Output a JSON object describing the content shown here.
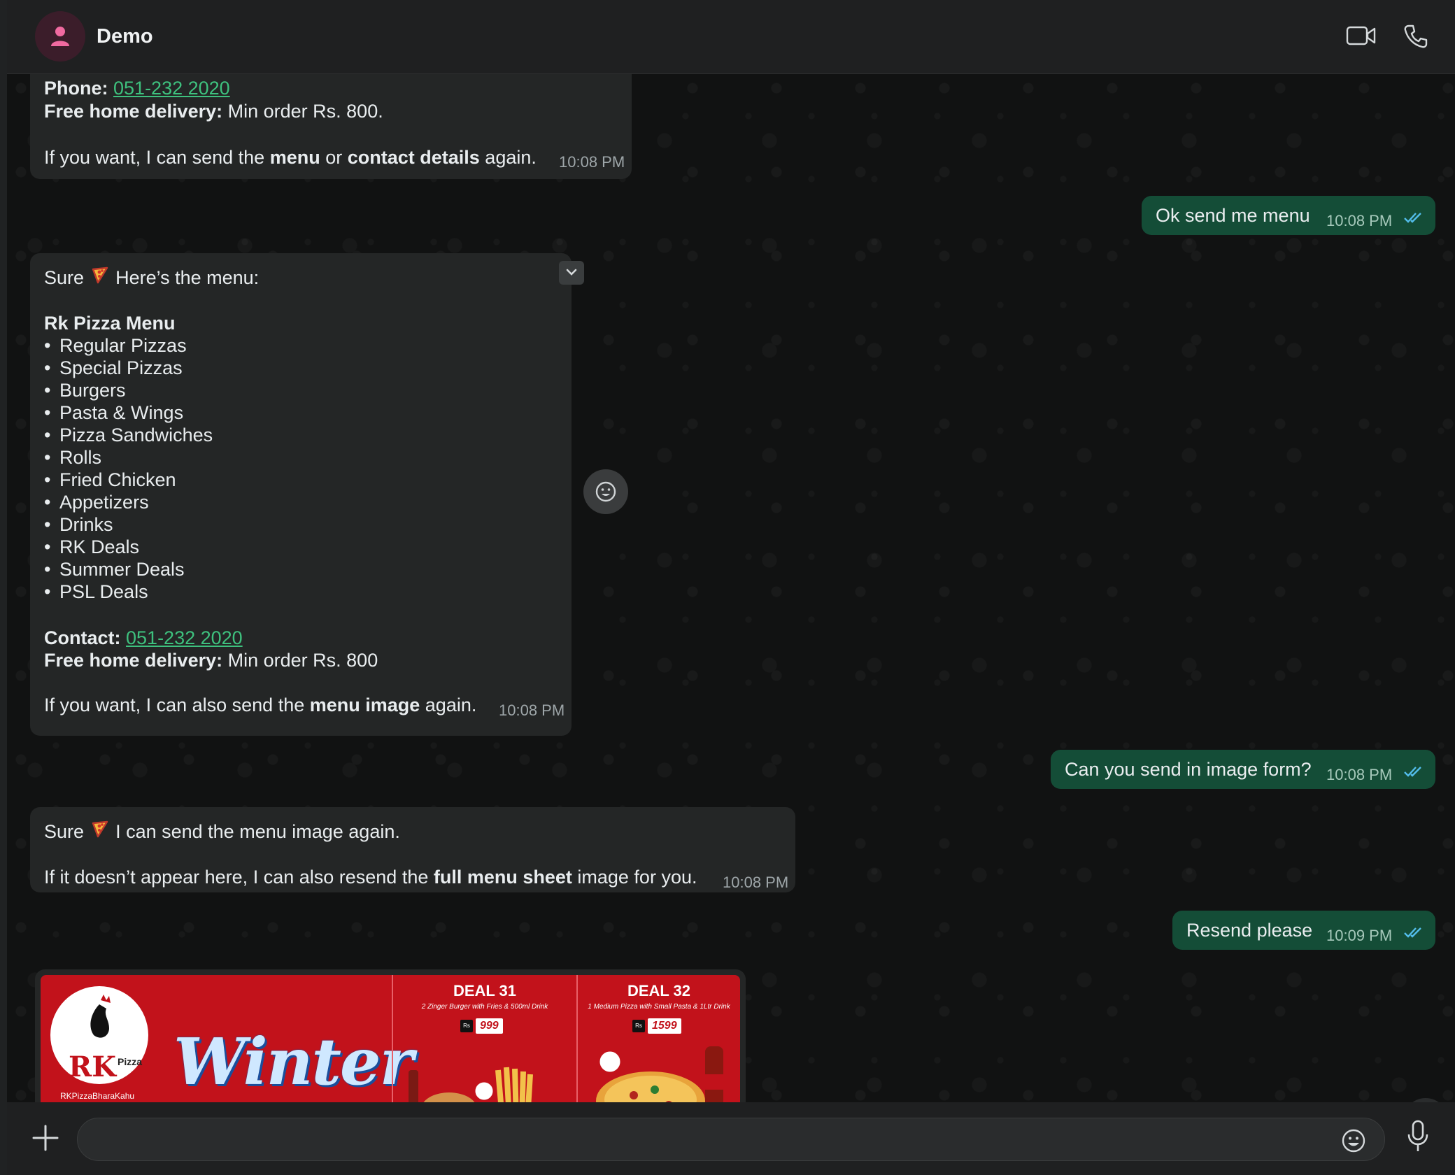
{
  "header": {
    "contact_name": "Demo",
    "icons": [
      "person-icon",
      "video-call-icon",
      "voice-call-icon"
    ]
  },
  "messages": {
    "m1": {
      "phone_label": "Phone:",
      "phone": "051-232 2020",
      "delivery_label": "Free home delivery:",
      "delivery_text": "Min order Rs. 800.",
      "p_pre": "If you want, I can send the ",
      "p_menu": "menu",
      "p_or": " or ",
      "p_contact": "contact details",
      "p_post": " again.",
      "time": "10:08 PM"
    },
    "m2": {
      "text": "Ok send me menu",
      "time": "10:08 PM"
    },
    "m3": {
      "intro_sure": "Sure",
      "intro_text": "Here’s the menu:",
      "menu_title": "Rk Pizza Menu",
      "items": [
        "Regular Pizzas",
        "Special Pizzas",
        "Burgers",
        "Pasta & Wings",
        "Pizza Sandwiches",
        "Rolls",
        "Fried Chicken",
        "Appetizers",
        "Drinks",
        "RK Deals",
        "Summer Deals",
        "PSL Deals"
      ],
      "contact_label": "Contact:",
      "contact": "051-232 2020",
      "delivery_label": "Free home delivery:",
      "delivery_text": "Min order Rs. 800",
      "p_pre": "If you want, I can also send the ",
      "p_bold": "menu image",
      "p_post": " again.",
      "time": "10:08 PM"
    },
    "m4": {
      "text": "Can you send in image form?",
      "time": "10:08 PM"
    },
    "m5": {
      "l1_sure": "Sure",
      "l1_text": "I can send the menu image again.",
      "p_pre": "If it doesn’t appear here, I can also resend the ",
      "p_bold": "full menu sheet",
      "p_post": " image for you.",
      "time": "10:08 PM"
    },
    "m6": {
      "text": "Resend please",
      "time": "10:09 PM"
    }
  },
  "poster": {
    "logo_text": "RK",
    "logo_sub": "Pizza",
    "social": "RKPizzaBharaKahu",
    "headline": "Winter",
    "deal31": {
      "title": "DEAL 31",
      "desc": "2 Zinger Burger with Fries & 500ml Drink",
      "currency": "Rs",
      "price": "999"
    },
    "deal32": {
      "title": "DEAL 32",
      "desc": "1 Medium Pizza with Small Pasta & 1Ltr Drink",
      "currency": "Rs",
      "price": "1599"
    }
  },
  "composer": {
    "value": "",
    "placeholder": ""
  },
  "colors": {
    "incoming_bubble": "#242626",
    "outgoing_bubble": "#144d37",
    "link": "#3ec17e",
    "read_ticks": "#53bdeb"
  }
}
